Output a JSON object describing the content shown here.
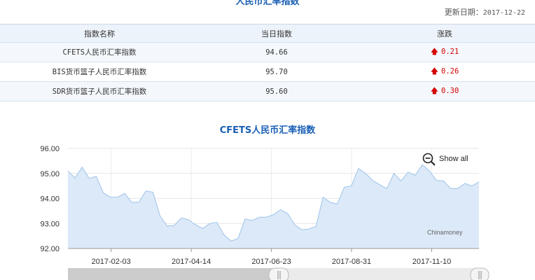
{
  "page": {
    "top_title": "人民币汇率指数",
    "update_label": "更新日期：",
    "update_date": "2017-12-22"
  },
  "table": {
    "headers": [
      "指数名称",
      "当日指数",
      "涨跌"
    ],
    "rows": [
      {
        "name": "CFETS人民币汇率指数",
        "value": "94.66",
        "change": "0.21"
      },
      {
        "name": "BIS货币篮子人民币汇率指数",
        "value": "95.70",
        "change": "0.26"
      },
      {
        "name": "SDR货币篮子人民币汇率指数",
        "value": "95.60",
        "change": "0.30"
      }
    ],
    "up_color": "#d40000"
  },
  "chart": {
    "show_all_label": "Show all",
    "credit": "Chinamoney"
  },
  "chart_data": {
    "type": "area",
    "title": "CFETS人民币汇率指数",
    "xlabel": "",
    "ylabel": "",
    "ylim": [
      92,
      96
    ],
    "y_ticks": [
      "92.00",
      "93.00",
      "94.00",
      "95.00",
      "96.00"
    ],
    "x_tick_labels": [
      "2017-02-03",
      "2017-04-14",
      "2017-06-23",
      "2017-08-31",
      "2017-11-10"
    ],
    "grid": true,
    "line_color": "#9ec4ea",
    "fill_color": "#dce9f8",
    "series": [
      {
        "values": [
          95.1,
          94.82,
          95.25,
          94.8,
          94.88,
          94.22,
          94.05,
          94.05,
          94.2,
          93.85,
          93.85,
          94.3,
          94.25,
          93.3,
          92.9,
          92.92,
          93.22,
          93.15,
          92.95,
          92.8,
          93.0,
          93.05,
          92.55,
          92.3,
          92.4,
          93.18,
          93.12,
          93.25,
          93.25,
          93.35,
          93.55,
          93.4,
          92.95,
          92.75,
          92.78,
          92.88,
          94.05,
          93.85,
          93.78,
          94.45,
          94.5,
          95.2,
          95.0,
          94.72,
          94.55,
          94.4,
          95.0,
          94.7,
          95.05,
          94.92,
          95.35,
          95.1,
          94.72,
          94.7,
          94.4,
          94.4,
          94.6,
          94.5,
          94.66
        ]
      }
    ]
  }
}
